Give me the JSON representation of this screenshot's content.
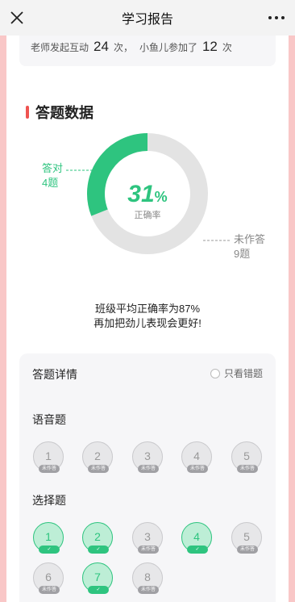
{
  "titlebar": {
    "title": "学习报告",
    "close_icon": "close-icon",
    "more_icon": "more-icon"
  },
  "interaction": {
    "prefix": "老师发起互动",
    "teacher_count": "24",
    "unit1": "次，",
    "middle": "小鱼儿参加了",
    "child_count": "12",
    "unit2": "次"
  },
  "answer_data": {
    "section_title": "答题数据",
    "accuracy": 31,
    "accuracy_value": "31",
    "accuracy_unit": "%",
    "accuracy_label": "正确率",
    "correct_label": "答对",
    "correct_count": "4题",
    "undone_label": "未作答",
    "undone_count": "9题",
    "colors": {
      "correct": "#2ec47f",
      "undone": "#e3e3e3"
    },
    "avg_line1": "班级平均正确率为87%",
    "avg_line2": "再加把劲儿表现会更好!"
  },
  "detail": {
    "title": "答题详情",
    "filter_label": "只看错题",
    "groups": [
      {
        "title": "语音题",
        "questions": [
          {
            "num": "1",
            "status": "未作答"
          },
          {
            "num": "2",
            "status": "未作答"
          },
          {
            "num": "3",
            "status": "未作答"
          },
          {
            "num": "4",
            "status": "未作答"
          },
          {
            "num": "5",
            "status": "未作答"
          }
        ]
      },
      {
        "title": "选择题",
        "questions": [
          {
            "num": "1",
            "status": "✓"
          },
          {
            "num": "2",
            "status": "✓"
          },
          {
            "num": "3",
            "status": "未作答"
          },
          {
            "num": "4",
            "status": "✓"
          },
          {
            "num": "5",
            "status": "未作答"
          },
          {
            "num": "6",
            "status": "未作答"
          },
          {
            "num": "7",
            "status": "✓"
          },
          {
            "num": "8",
            "status": "未作答"
          }
        ]
      }
    ]
  }
}
